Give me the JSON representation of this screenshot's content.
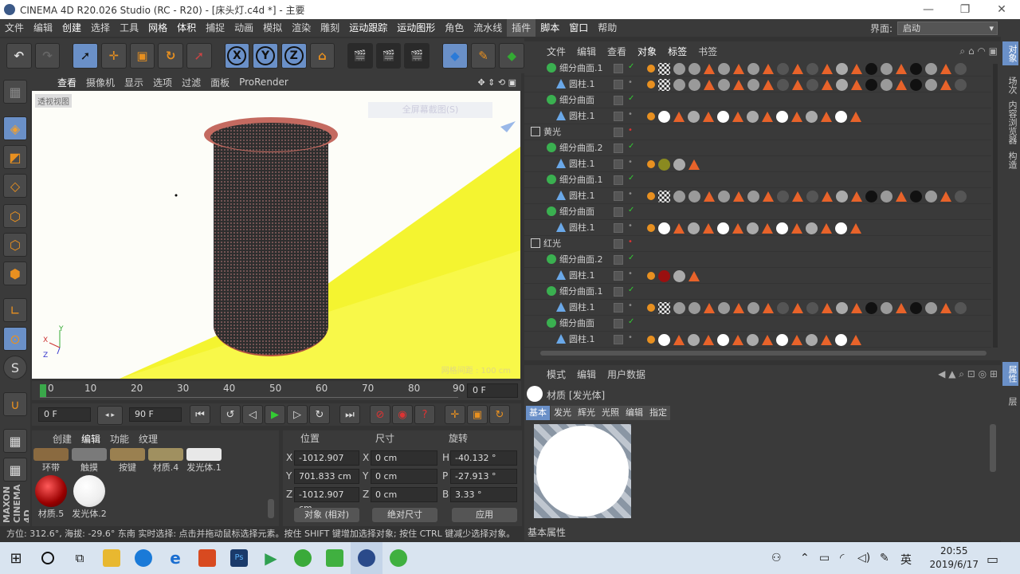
{
  "window": {
    "title": "CINEMA 4D R20.026 Studio (RC - R20) - [床头灯.c4d *] - 主要",
    "min": "—",
    "max": "❐",
    "close": "✕"
  },
  "menubar": {
    "items": [
      "文件",
      "编辑",
      "创建",
      "选择",
      "工具",
      "网格",
      "体积",
      "捕捉",
      "动画",
      "模拟",
      "渲染",
      "雕刻",
      "运动跟踪",
      "运动图形",
      "角色",
      "流水线",
      "插件",
      "脚本",
      "窗口",
      "帮助"
    ],
    "layout_label": "界面:",
    "layout_value": "启动"
  },
  "viewport": {
    "menus": [
      "查看",
      "摄像机",
      "显示",
      "选项",
      "过滤",
      "面板",
      "ProRender"
    ],
    "camera_label": "透视视图",
    "overlay_button": "全屏幕截图(S)",
    "grid_spacing": "网格间距 : 100 cm",
    "axis_x": "X",
    "axis_y": "Y",
    "axis_z": "Z"
  },
  "timeline": {
    "ticks": [
      "0",
      "10",
      "20",
      "30",
      "40",
      "50",
      "60",
      "70",
      "80",
      "90"
    ],
    "current_frame": "0 F"
  },
  "playback": {
    "start": "0 F",
    "end": "90 F"
  },
  "materials": {
    "tabs": [
      "创建",
      "编辑",
      "功能",
      "纹理"
    ],
    "items": [
      {
        "name": "环带",
        "color": "#8a6a40"
      },
      {
        "name": "触摸",
        "color": "#7a7a7a"
      },
      {
        "name": "按键",
        "color": "#9a8050"
      },
      {
        "name": "材质.4",
        "color": "#a09060"
      },
      {
        "name": "发光体.1",
        "color": "#e8e8e8"
      },
      {
        "name": "材质.5",
        "color": "#b01818"
      },
      {
        "name": "发光体.2",
        "color": "#f4f4f4"
      }
    ]
  },
  "coords": {
    "headers": [
      "位置",
      "尺寸",
      "旋转"
    ],
    "rows": [
      {
        "axis": "X",
        "pos": "-1012.907 cm",
        "size_axis": "X",
        "size": "0 cm",
        "rot_axis": "H",
        "rot": "-40.132 °"
      },
      {
        "axis": "Y",
        "pos": "701.833 cm",
        "size_axis": "Y",
        "size": "0 cm",
        "rot_axis": "P",
        "rot": "-27.913 °"
      },
      {
        "axis": "Z",
        "pos": "-1012.907 cm",
        "size_axis": "Z",
        "size": "0 cm",
        "rot_axis": "B",
        "rot": "3.33 °"
      }
    ],
    "mode": "对象 (相对)",
    "size_mode": "绝对尺寸",
    "apply": "应用"
  },
  "status": "方位: 312.6°, 海拔: -29.6° 东南    实时选择: 点击并拖动鼠标选择元素。按住 SHIFT 键增加选择对象; 按住 CTRL 键减少选择对象。",
  "objects": {
    "menus": [
      "文件",
      "编辑",
      "查看",
      "对象",
      "标签",
      "书签"
    ],
    "rows": [
      {
        "name": "细分曲面.1",
        "type": "subd",
        "indent": 1,
        "check": true,
        "tags": "long"
      },
      {
        "name": "圆柱.1",
        "type": "cyl",
        "indent": 2,
        "check": false,
        "tags": "long"
      },
      {
        "name": "细分曲面",
        "type": "subd",
        "indent": 1,
        "check": true,
        "tags": "none"
      },
      {
        "name": "圆柱.1",
        "type": "cyl",
        "indent": 2,
        "check": false,
        "tags": "white"
      },
      {
        "name": "黄光",
        "type": "null",
        "indent": 0,
        "check": false,
        "tags": "none"
      },
      {
        "name": "细分曲面.2",
        "type": "subd",
        "indent": 1,
        "check": true,
        "tags": "none"
      },
      {
        "name": "圆柱.1",
        "type": "cyl",
        "indent": 2,
        "check": false,
        "tags": "yellow"
      },
      {
        "name": "细分曲面.1",
        "type": "subd",
        "indent": 1,
        "check": true,
        "tags": "none"
      },
      {
        "name": "圆柱.1",
        "type": "cyl",
        "indent": 2,
        "check": false,
        "tags": "long"
      },
      {
        "name": "细分曲面",
        "type": "subd",
        "indent": 1,
        "check": true,
        "tags": "none"
      },
      {
        "name": "圆柱.1",
        "type": "cyl",
        "indent": 2,
        "check": false,
        "tags": "white"
      },
      {
        "name": "红光",
        "type": "null",
        "indent": 0,
        "check": false,
        "tags": "none"
      },
      {
        "name": "细分曲面.2",
        "type": "subd",
        "indent": 1,
        "check": true,
        "tags": "none"
      },
      {
        "name": "圆柱.1",
        "type": "cyl",
        "indent": 2,
        "check": false,
        "tags": "red"
      },
      {
        "name": "细分曲面.1",
        "type": "subd",
        "indent": 1,
        "check": true,
        "tags": "none"
      },
      {
        "name": "圆柱.1",
        "type": "cyl",
        "indent": 2,
        "check": false,
        "tags": "long"
      },
      {
        "name": "细分曲面",
        "type": "subd",
        "indent": 1,
        "check": true,
        "tags": "none"
      },
      {
        "name": "圆柱.1",
        "type": "cyl",
        "indent": 2,
        "check": false,
        "tags": "white"
      }
    ]
  },
  "attributes": {
    "menus": [
      "模式",
      "编辑",
      "用户数据"
    ],
    "title": "材质 [发光体]",
    "tabs": [
      "基本",
      "发光",
      "辉光",
      "光照",
      "编辑",
      "指定"
    ],
    "section": "基本属性"
  },
  "right_tabs": [
    "对象",
    "场次",
    "内容浏览器",
    "构造",
    "属性",
    "层"
  ],
  "left_brand": "MAXON CINEMA 4D",
  "taskbar": {
    "time": "20:55",
    "date": "2019/6/17",
    "ime": "英",
    "apps": [
      {
        "name": "start",
        "color": "#1a1a1a"
      },
      {
        "name": "cortana",
        "color": "#1a1a1a"
      },
      {
        "name": "taskview",
        "color": "#1a1a1a"
      },
      {
        "name": "explorer",
        "color": "#e8b830"
      },
      {
        "name": "kugou",
        "color": "#1a7ad8"
      },
      {
        "name": "edge",
        "color": "#1a6ed0"
      },
      {
        "name": "wps",
        "color": "#d84a20"
      },
      {
        "name": "photoshop",
        "color": "#1a3a6a"
      },
      {
        "name": "player",
        "color": "#30a050"
      },
      {
        "name": "wechat",
        "color": "#3aaa3a"
      },
      {
        "name": "iqiyi",
        "color": "#40b040"
      },
      {
        "name": "cinema4d",
        "color": "#2a4a8a"
      },
      {
        "name": "green-app",
        "color": "#40b040"
      }
    ]
  }
}
